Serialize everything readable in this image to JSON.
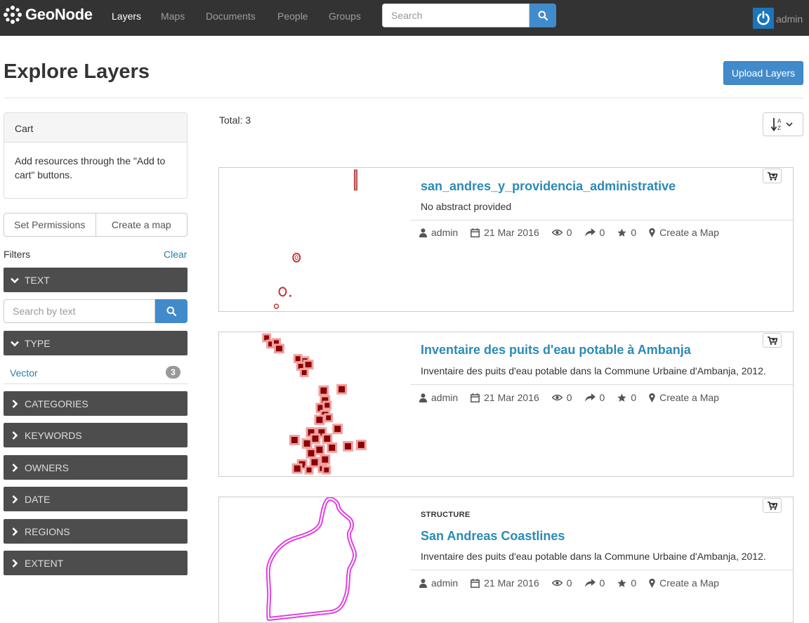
{
  "app": {
    "brand": "GeoNode",
    "user": "admin"
  },
  "nav": {
    "items": [
      {
        "label": "Layers",
        "active": true
      },
      {
        "label": "Maps"
      },
      {
        "label": "Documents"
      },
      {
        "label": "People"
      },
      {
        "label": "Groups"
      }
    ],
    "search_placeholder": "Search"
  },
  "header": {
    "title": "Explore Layers",
    "upload_label": "Upload Layers"
  },
  "sidebar": {
    "cart": {
      "title": "Cart",
      "body": "Add resources through the \"Add to cart\" buttons."
    },
    "actions": {
      "set_permissions": "Set Permissions",
      "create_map": "Create a map"
    },
    "filters_label": "Filters",
    "clear_label": "Clear",
    "text_search_placeholder": "Search by text",
    "facets": {
      "text": "TEXT",
      "type": "TYPE",
      "categories": "CATEGORIES",
      "keywords": "KEYWORDS",
      "owners": "OWNERS",
      "date": "DATE",
      "regions": "REGIONS",
      "extent": "EXTENT"
    },
    "type_values": [
      {
        "label": "Vector",
        "count": "3"
      }
    ]
  },
  "results": {
    "total": "Total: 3",
    "items": [
      {
        "category": "",
        "title": "san_andres_y_providencia_administrative",
        "abstract": "No abstract provided",
        "owner": "admin",
        "date": "21 Mar 2016",
        "views": "0",
        "shares": "0",
        "rating": "0",
        "create_map": "Create a Map"
      },
      {
        "category": "",
        "title": "Inventaire des puits d'eau potable à Ambanja",
        "abstract": "Inventaire des puits d'eau potable dans la Commune Urbaine d'Ambanja, 2012.",
        "owner": "admin",
        "date": "21 Mar 2016",
        "views": "0",
        "shares": "0",
        "rating": "0",
        "create_map": "Create a Map"
      },
      {
        "category": "STRUCTURE",
        "title": "San Andreas Coastlines",
        "abstract": "Inventaire des puits d'eau potable dans la Commune Urbaine d'Ambanja, 2012.",
        "owner": "admin",
        "date": "21 Mar 2016",
        "views": "0",
        "shares": "0",
        "rating": "0",
        "create_map": "Create a Map"
      }
    ]
  },
  "colors": {
    "navbar": "#333333",
    "primary": "#428bca",
    "link": "#2a8bb5",
    "facet": "#4d4d4d"
  }
}
